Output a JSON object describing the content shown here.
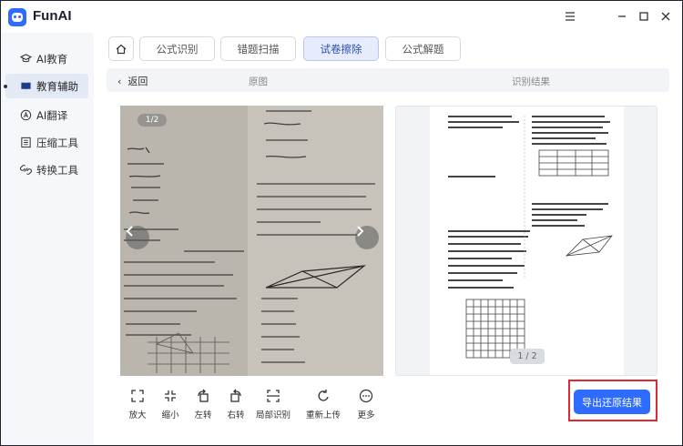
{
  "app": {
    "title": "FunAI"
  },
  "window_controls": [
    "menu-icon",
    "minimize-icon",
    "maximize-icon",
    "close-icon"
  ],
  "sidebar": {
    "items": [
      {
        "label": "AI教育",
        "icon": "graduation-cap-icon",
        "active": false
      },
      {
        "label": "教育辅助",
        "icon": "book-icon",
        "active": true
      },
      {
        "label": "AI翻译",
        "icon": "translate-icon",
        "active": false
      },
      {
        "label": "压缩工具",
        "icon": "compress-icon",
        "active": false
      },
      {
        "label": "转换工具",
        "icon": "convert-icon",
        "active": false
      }
    ]
  },
  "tabs": [
    {
      "label": "公式识别",
      "active": false
    },
    {
      "label": "错题扫描",
      "active": false
    },
    {
      "label": "试卷擦除",
      "active": true
    },
    {
      "label": "公式解题",
      "active": false
    }
  ],
  "subheader": {
    "back_label": "返回",
    "original_label": "原图",
    "result_label": "识别结果"
  },
  "original": {
    "page_indicator": "1/2"
  },
  "result": {
    "page_indicator": "1 / 2"
  },
  "toolbar": [
    {
      "label": "放大",
      "icon": "zoom-in-icon"
    },
    {
      "label": "缩小",
      "icon": "zoom-out-icon"
    },
    {
      "label": "左转",
      "icon": "rotate-left-icon"
    },
    {
      "label": "右转",
      "icon": "rotate-right-icon"
    },
    {
      "label": "局部识别",
      "icon": "partial-recognize-icon"
    },
    {
      "label": "重新上传",
      "icon": "reupload-icon"
    },
    {
      "label": "更多",
      "icon": "more-icon"
    }
  ],
  "export_button": "导出还原结果",
  "colors": {
    "accent": "#2f6bff",
    "highlight_frame": "#e0282f",
    "active_tab_bg": "#e6ecfb"
  }
}
